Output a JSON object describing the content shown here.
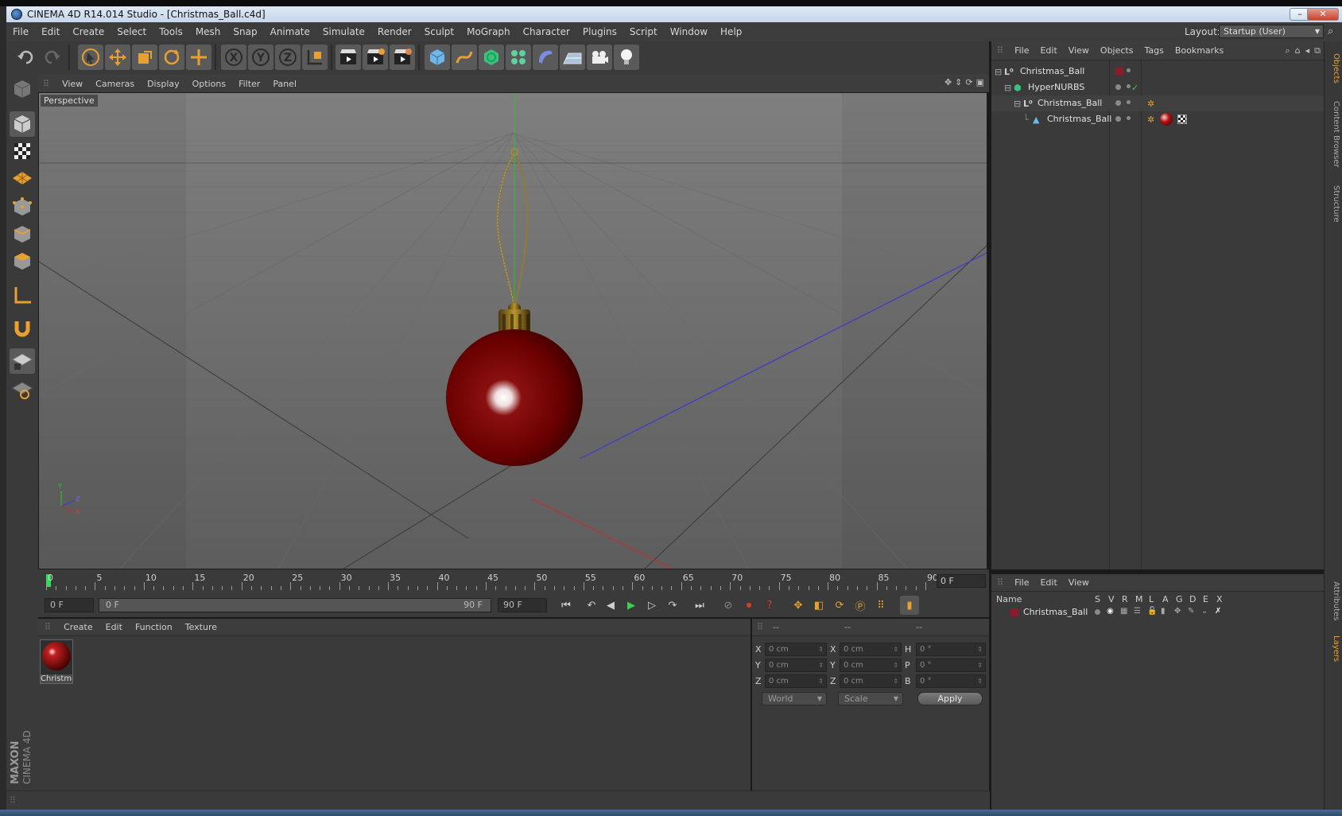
{
  "window": {
    "title": "CINEMA 4D R14.014 Studio - [Christmas_Ball.c4d]",
    "minimize": "–",
    "maximize": "❐",
    "close": "✕"
  },
  "menubar": {
    "items": [
      "File",
      "Edit",
      "Create",
      "Select",
      "Tools",
      "Mesh",
      "Snap",
      "Animate",
      "Simulate",
      "Render",
      "Sculpt",
      "MoGraph",
      "Character",
      "Plugins",
      "Script",
      "Window",
      "Help"
    ],
    "layout_label": "Layout:",
    "layout_value": "Startup (User)"
  },
  "viewport": {
    "menu": [
      "View",
      "Cameras",
      "Display",
      "Options",
      "Filter",
      "Panel"
    ],
    "camera_label": "Perspective",
    "axis_y": "Y",
    "axis_z": "Z",
    "axis_x": "X"
  },
  "timeline": {
    "tick_labels": [
      "0",
      "5",
      "10",
      "15",
      "20",
      "25",
      "30",
      "35",
      "40",
      "45",
      "50",
      "55",
      "60",
      "65",
      "70",
      "75",
      "80",
      "85",
      "90"
    ],
    "current_frame": "0 F"
  },
  "playback": {
    "start_field": "0 F",
    "range_start": "0 F",
    "range_end": "90 F",
    "end_field": "90 F"
  },
  "materials": {
    "menu": [
      "Create",
      "Edit",
      "Function",
      "Texture"
    ],
    "items": [
      {
        "name": "Christma"
      }
    ]
  },
  "coordinates": {
    "headers": [
      "--",
      "--",
      "--"
    ],
    "rows": [
      {
        "l1": "X",
        "v1": "0 cm",
        "l2": "X",
        "v2": "0 cm",
        "l3": "H",
        "v3": "0 °"
      },
      {
        "l1": "Y",
        "v1": "0 cm",
        "l2": "Y",
        "v2": "0 cm",
        "l3": "P",
        "v3": "0 °"
      },
      {
        "l1": "Z",
        "v1": "0 cm",
        "l2": "Z",
        "v2": "0 cm",
        "l3": "B",
        "v3": "0 °"
      }
    ],
    "mode_world": "World",
    "mode_scale": "Scale",
    "apply": "Apply"
  },
  "objects": {
    "menu": [
      "File",
      "Edit",
      "View",
      "Objects",
      "Tags",
      "Bookmarks"
    ],
    "tree": [
      {
        "name": "Christmas_Ball",
        "type": "null"
      },
      {
        "name": "HyperNURBS",
        "type": "hypernurbs"
      },
      {
        "name": "Christmas_Ball",
        "type": "null"
      },
      {
        "name": "Christmas_Ball",
        "type": "polygon"
      }
    ]
  },
  "layers": {
    "menu": [
      "File",
      "Edit",
      "View"
    ],
    "columns": [
      "Name",
      "S",
      "V",
      "R",
      "M",
      "L",
      "A",
      "G",
      "D",
      "E",
      "X"
    ],
    "rows": [
      {
        "name": "Christmas_Ball",
        "color": "#8b1a2a"
      }
    ]
  },
  "right_tabs": [
    "Objects",
    "Content Browser",
    "Structure",
    "Attributes",
    "Layers"
  ],
  "branding": {
    "line1": "MAXON",
    "line2": "CINEMA 4D"
  },
  "colors": {
    "accent": "#e8a030",
    "ball": "#7a0000",
    "background": "#3a3a3a"
  }
}
